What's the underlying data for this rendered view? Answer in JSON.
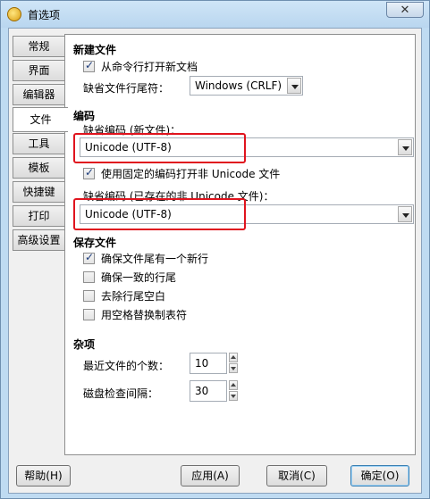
{
  "window": {
    "title": "首选项",
    "close_glyph": "✕"
  },
  "tabs": [
    {
      "label": "常规"
    },
    {
      "label": "界面"
    },
    {
      "label": "编辑器"
    },
    {
      "label": "文件"
    },
    {
      "label": "工具"
    },
    {
      "label": "模板"
    },
    {
      "label": "快捷键"
    },
    {
      "label": "打印"
    },
    {
      "label": "高级设置"
    }
  ],
  "active_tab": "文件",
  "new_file": {
    "heading": "新建文件",
    "open_from_cmdline": {
      "label": "从命令行打开新文档",
      "checked": true
    },
    "line_ending_label": "缺省文件行尾符：",
    "line_ending_value": "Windows (CRLF)"
  },
  "encoding": {
    "heading": "编码",
    "default_new_label": "缺省编码 (新文件)：",
    "default_new_value": "Unicode (UTF-8)",
    "fixed_encoding": {
      "label": "使用固定的编码打开非 Unicode 文件",
      "checked": true
    },
    "default_existing_label": "缺省编码 (已存在的非 Unicode 文件)：",
    "default_existing_value": "Unicode (UTF-8)"
  },
  "save_file": {
    "heading": "保存文件",
    "options": [
      {
        "label": "确保文件尾有一个新行",
        "checked": true
      },
      {
        "label": "确保一致的行尾",
        "checked": false
      },
      {
        "label": "去除行尾空白",
        "checked": false
      },
      {
        "label": "用空格替换制表符",
        "checked": false
      }
    ]
  },
  "misc": {
    "heading": "杂项",
    "recent_files_label": "最近文件的个数：",
    "recent_files_value": "10",
    "disk_check_label": "磁盘检查间隔：",
    "disk_check_value": "30"
  },
  "buttons": {
    "help": "帮助(H)",
    "apply": "应用(A)",
    "cancel": "取消(C)",
    "ok": "确定(O)"
  },
  "colors": {
    "highlight": "#e0141e",
    "titlebar": "#bfdbf2"
  }
}
